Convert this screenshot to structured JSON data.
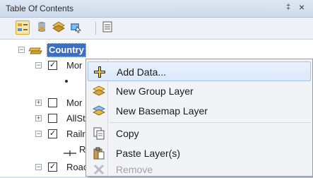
{
  "window": {
    "title": "Table Of Contents",
    "pin_glyph": "‡",
    "close_glyph": "×"
  },
  "toolbar": {
    "buttons": [
      {
        "icon": "list-by-drawing-order-icon",
        "active": true
      },
      {
        "icon": "list-by-source-icon"
      },
      {
        "icon": "list-by-visibility-icon"
      },
      {
        "icon": "list-by-selection-icon"
      },
      {
        "icon": "options-icon"
      }
    ]
  },
  "tree": {
    "rows": [
      {
        "label": "Country",
        "expander": "−",
        "selected": true
      },
      {
        "label": "Mor",
        "expander": "−",
        "checked": true
      },
      {
        "label": "",
        "symbol": "point"
      },
      {
        "label": "Mor",
        "expander": "+",
        "checked": false
      },
      {
        "label": "AllSt",
        "expander": "+",
        "checked": false
      },
      {
        "label": "Railr",
        "expander": "−",
        "checked": true
      },
      {
        "label": "R",
        "symbol": "railroad-line"
      },
      {
        "label": "Roac",
        "expander": "−",
        "checked": true
      }
    ]
  },
  "context_menu": {
    "items": [
      {
        "label": "Add Data...",
        "icon": "add-data-icon",
        "hover": true
      },
      {
        "label": "New Group Layer",
        "icon": "group-layer-icon"
      },
      {
        "label": "New Basemap Layer",
        "icon": "basemap-layer-icon"
      },
      {
        "label": "Copy",
        "icon": "copy-icon"
      },
      {
        "label": "Paste Layer(s)",
        "icon": "paste-icon"
      },
      {
        "label": "Remove",
        "icon": "remove-icon",
        "disabled": true
      }
    ]
  },
  "colors": {
    "selection": "#3a6fc5",
    "menu_hover": "#dae8fa",
    "panel_bg": "#dbe4f1"
  }
}
